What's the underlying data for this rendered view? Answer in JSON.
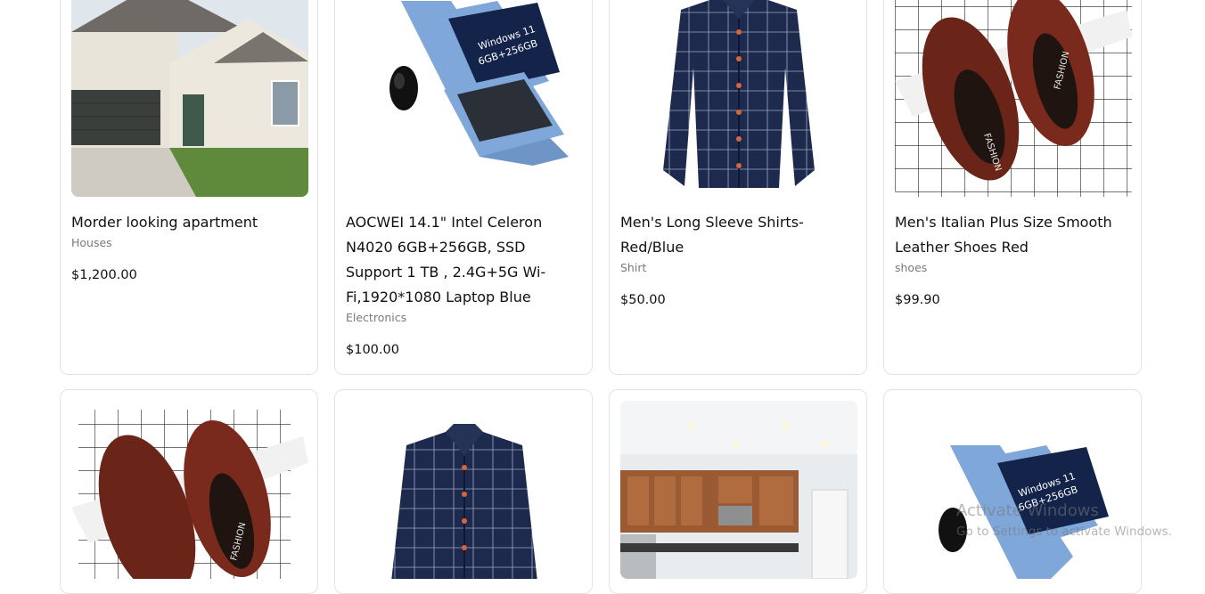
{
  "products": [
    {
      "title": "Morder looking apartment",
      "category": "Houses",
      "price": "$1,200.00",
      "image_icon": "house-image"
    },
    {
      "title": "AOCWEI 14.1\" Intel Celeron N4020 6GB+256GB, SSD Support 1 TB , 2.4G+5G Wi-Fi,1920*1080 Laptop Blue",
      "category": "Electronics",
      "price": "$100.00",
      "image_icon": "laptop-image",
      "screen_text": [
        "Windows 11",
        "6GB+256GB"
      ]
    },
    {
      "title": "Men's Long Sleeve Shirts-Red/Blue",
      "category": "Shirt",
      "price": "$50.00",
      "image_icon": "shirt-image"
    },
    {
      "title": "Men's Italian Plus Size Smooth Leather Shoes Red",
      "category": "shoes",
      "price": "$99.90",
      "image_icon": "shoes-image",
      "sole_text": "FASHION"
    }
  ],
  "row2_images": [
    {
      "image_icon": "shoes-image",
      "sole_text": "FASHION"
    },
    {
      "image_icon": "shirt-image"
    },
    {
      "image_icon": "kitchen-image"
    },
    {
      "image_icon": "laptop-image",
      "screen_text": [
        "Windows 11",
        "6GB+256GB"
      ]
    }
  ],
  "watermark": {
    "line1": "Activate Windows",
    "line2": "Go to Settings to activate Windows."
  },
  "colors": {
    "card_border": "#e3e3e3",
    "category_text": "#7a7a7a",
    "shirt_navy": "#1d2a4d",
    "laptop_blue": "#7fa7d9",
    "shoe_brown": "#6b2418"
  }
}
